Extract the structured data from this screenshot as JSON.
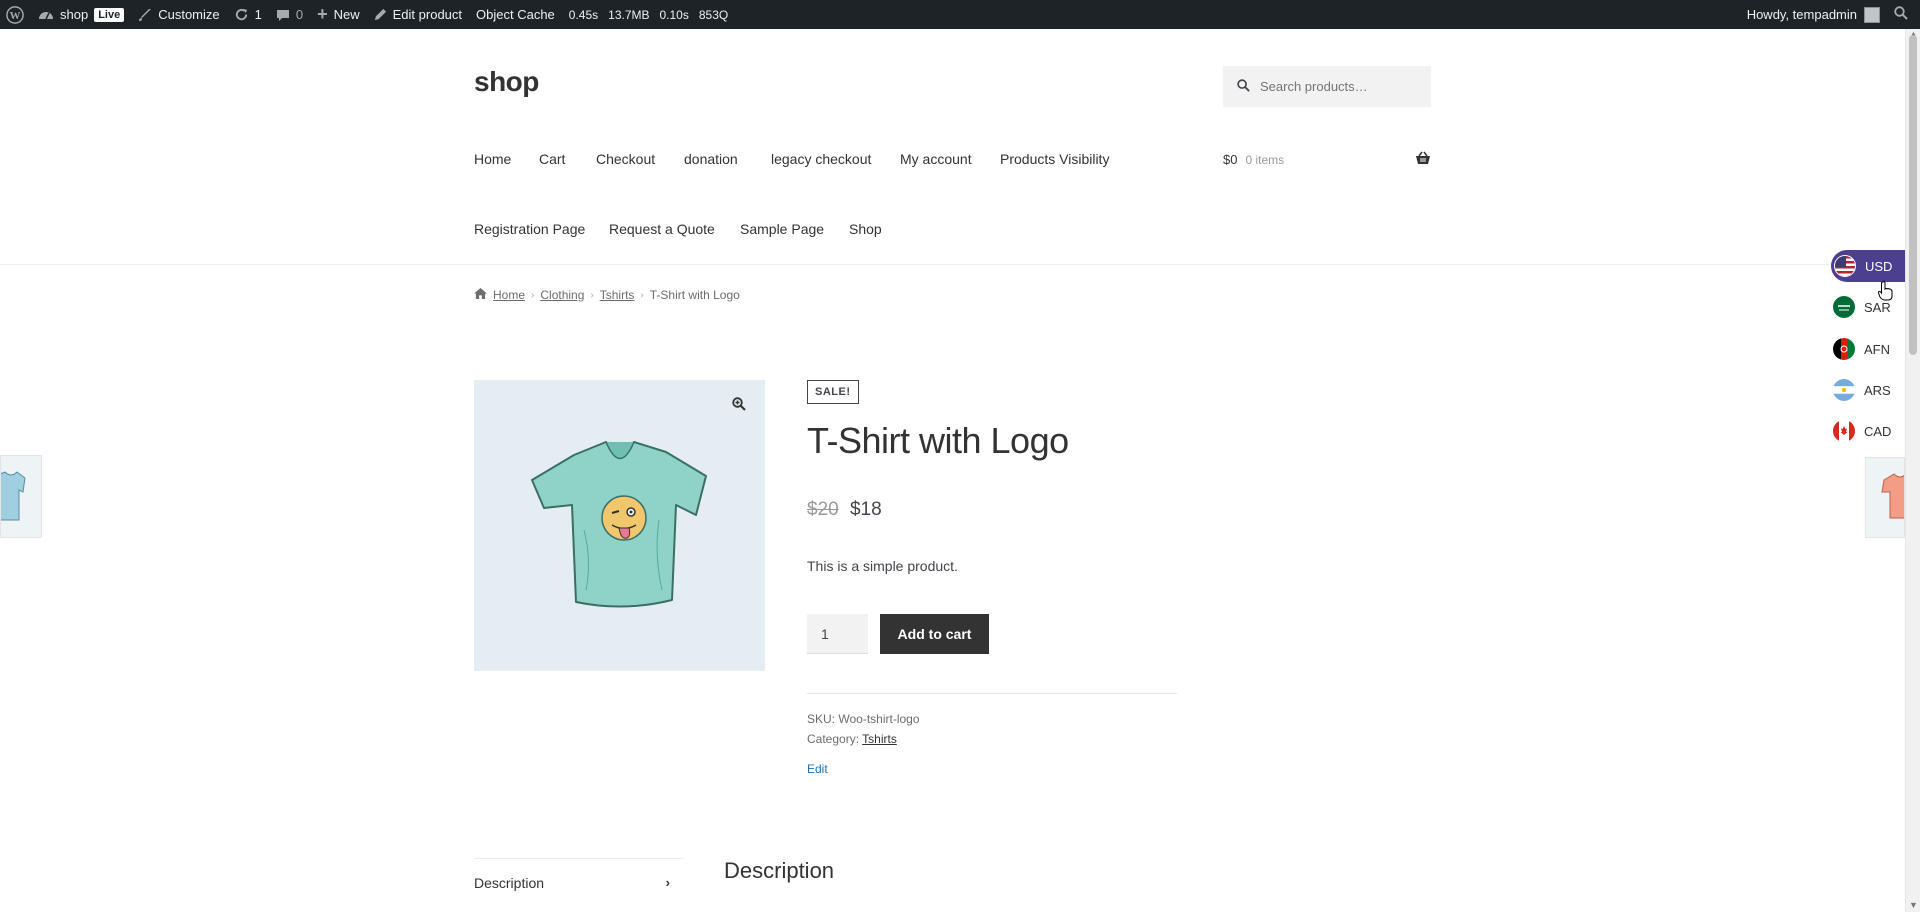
{
  "adminbar": {
    "site_name": "shop",
    "live_badge": "Live",
    "customize": "Customize",
    "updates_count": "1",
    "comments_count": "0",
    "new_label": "New",
    "edit_product": "Edit product",
    "object_cache": "Object Cache",
    "perf": [
      "0.45s",
      "13.7MB",
      "0.10s",
      "853Q"
    ],
    "howdy": "Howdy, tempadmin"
  },
  "header": {
    "site_title": "shop",
    "search_placeholder": "Search products…",
    "nav": [
      "Home",
      "Cart",
      "Checkout",
      "donation",
      "legacy checkout",
      "My account",
      "Products Visibility",
      "Registration Page",
      "Request a Quote",
      "Sample Page",
      "Shop"
    ],
    "cart_amount": "$0",
    "cart_count": "0 items"
  },
  "breadcrumb": [
    "Home",
    "Clothing",
    "Tshirts",
    "T-Shirt with Logo"
  ],
  "product": {
    "sale_badge": "SALE!",
    "title": "T-Shirt with Logo",
    "old_price": "$20",
    "price": "$18",
    "short_description": "This is a simple product.",
    "quantity": "1",
    "add_to_cart": "Add to cart",
    "sku_label": "SKU:",
    "sku": "Woo-tshirt-logo",
    "category_label": "Category:",
    "category": "Tshirts",
    "edit_link": "Edit"
  },
  "tabs": {
    "description_tab": "Description",
    "description_heading": "Description"
  },
  "currencies": [
    {
      "code": "USD",
      "selected": true
    },
    {
      "code": "SAR",
      "selected": false
    },
    {
      "code": "AFN",
      "selected": false
    },
    {
      "code": "ARS",
      "selected": false
    },
    {
      "code": "CAD",
      "selected": false
    }
  ],
  "colors": {
    "adminbar_bg": "#1d2327",
    "currency_selected_bg": "#4d3f8f",
    "button_bg": "#333333",
    "product_image_bg": "#e4eef2",
    "tshirt_green": "#8fd3c8"
  }
}
